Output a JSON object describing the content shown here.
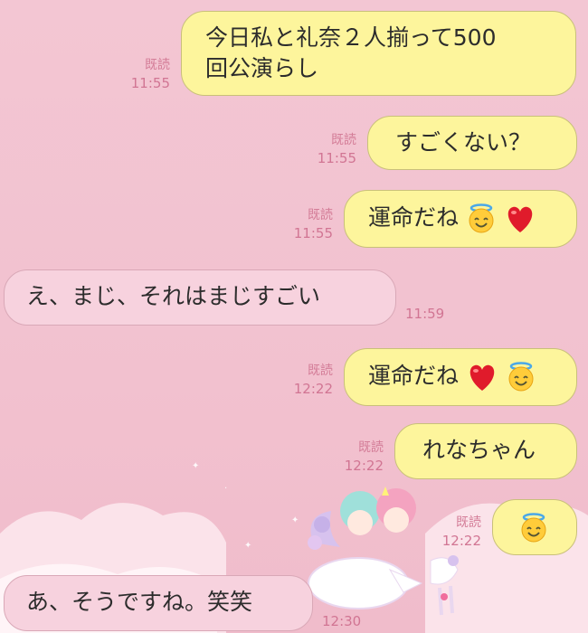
{
  "messages": [
    {
      "side": "out",
      "text_line1": "今日私と礼奈２人揃って500",
      "text_line2": "回公演らし",
      "read": "既読",
      "time": "11:55"
    },
    {
      "side": "out",
      "text": "すごくない？",
      "read": "既読",
      "time": "11:55"
    },
    {
      "side": "out",
      "text": "運命だね",
      "emojis": [
        "halo-smile",
        "heart"
      ],
      "read": "既読",
      "time": "11:55"
    },
    {
      "side": "in",
      "text": "え、まじ、それはまじすごい",
      "time": "11:59"
    },
    {
      "side": "out",
      "text": "運命だね",
      "emojis": [
        "heart",
        "halo-smile"
      ],
      "read": "既読",
      "time": "12:22"
    },
    {
      "side": "out",
      "text": "れなちゃん",
      "read": "既読",
      "time": "12:22"
    },
    {
      "side": "out",
      "text": "",
      "emojis": [
        "halo-smile"
      ],
      "read": "既読",
      "time": "12:22"
    },
    {
      "side": "in",
      "text": "あ、そうですね。笑笑",
      "time": "12:30"
    }
  ],
  "colors": {
    "out_bubble": "#fdf59c",
    "in_bubble": "#f7d2de",
    "background": "#f2c1cf",
    "meta": "#d17593"
  }
}
